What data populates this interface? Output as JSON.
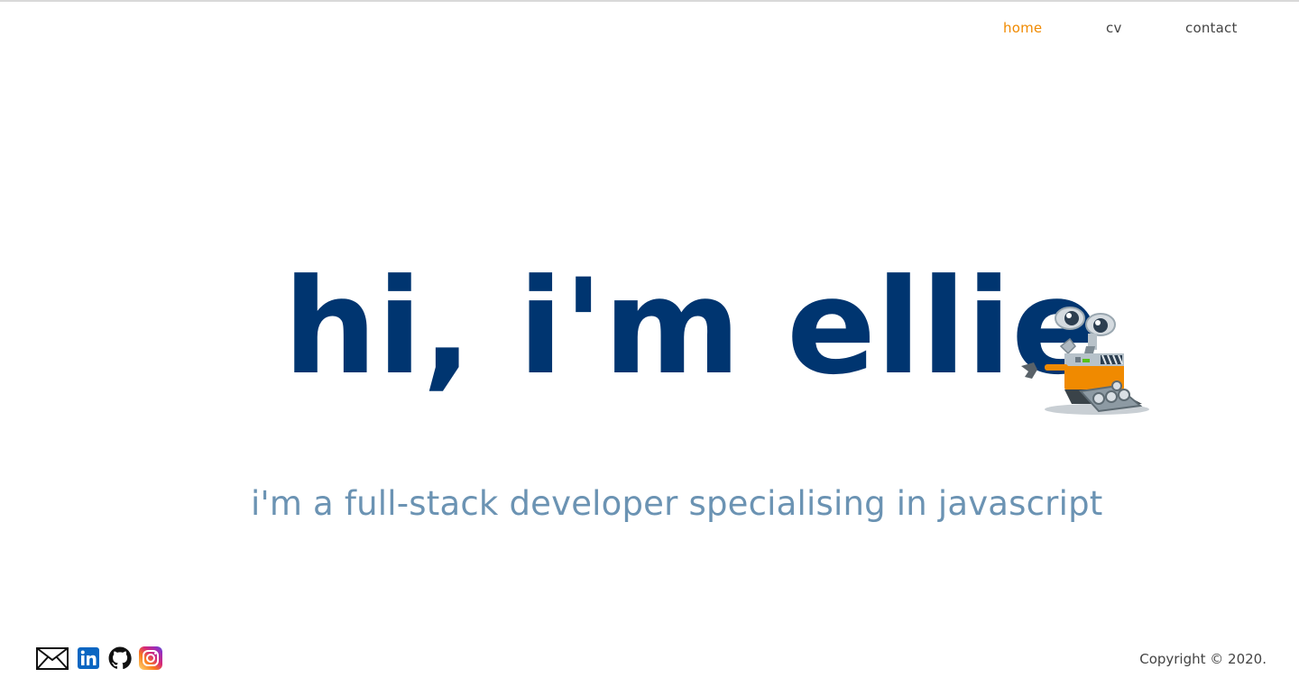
{
  "nav": {
    "items": [
      {
        "label": "home",
        "active": true
      },
      {
        "label": "cv",
        "active": false
      },
      {
        "label": "contact",
        "active": false
      }
    ]
  },
  "hero": {
    "title": "hi, i'm ellie",
    "subtitle": "i'm a full-stack developer specialising in javascript",
    "mascot_icon": "robot-mascot-icon"
  },
  "footer": {
    "social_icons": [
      "mail-icon",
      "linkedin-icon",
      "github-icon",
      "instagram-icon"
    ],
    "copyright": "Copyright © 2020."
  },
  "colors": {
    "accent": "#f08a00",
    "title": "#003570",
    "subtitle": "#6b93b3",
    "text": "#444444"
  }
}
